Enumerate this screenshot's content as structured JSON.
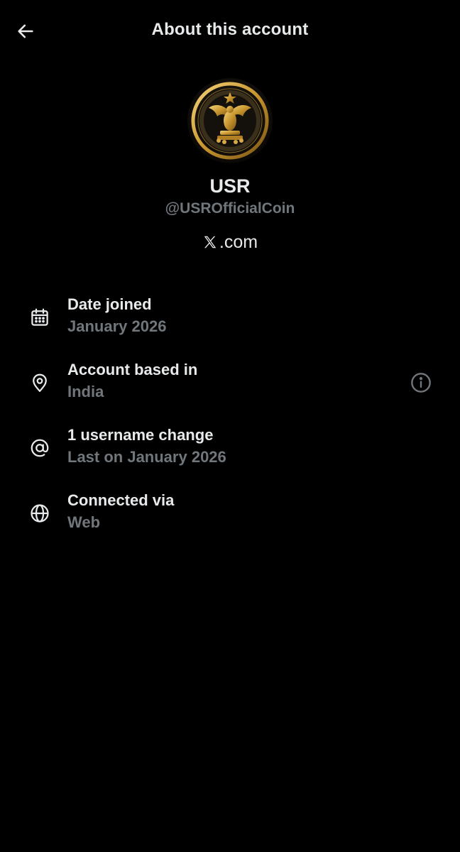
{
  "header": {
    "title": "About this account",
    "back_icon": "arrow-left-icon"
  },
  "profile": {
    "display_name": "USR",
    "handle": "@USROfficialCoin",
    "website": ".com",
    "website_prefix_icon": "x-logo-icon",
    "avatar_icon": "eagle-seal-avatar"
  },
  "info": [
    {
      "icon": "calendar-icon",
      "label": "Date joined",
      "value": "January 2026"
    },
    {
      "icon": "location-pin-icon",
      "label": "Account based in",
      "value": "India",
      "help_icon": "info-circle-icon"
    },
    {
      "icon": "at-sign-icon",
      "label": "1 username change",
      "value": "Last on January 2026"
    },
    {
      "icon": "globe-icon",
      "label": "Connected via",
      "value": "Web"
    }
  ],
  "colors": {
    "background": "#000000",
    "primary_text": "#e7e9ea",
    "secondary_text": "#71767b",
    "avatar_gold": "#c8962e"
  }
}
